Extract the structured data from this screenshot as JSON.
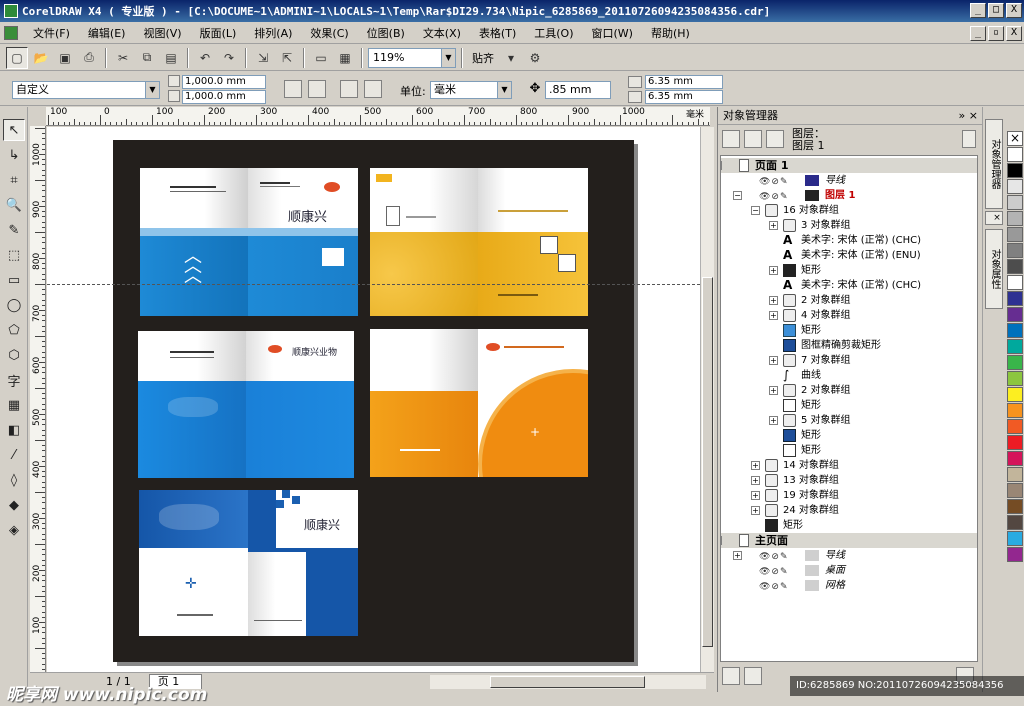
{
  "titlebar": {
    "title": "CorelDRAW X4 ( 专业版 ) - [C:\\DOCUME~1\\ADMINI~1\\LOCALS~1\\Temp\\Rar$DI29.734\\Nipic_6285869_20110726094235084356.cdr]",
    "btn_min": "_",
    "btn_max": "□",
    "btn_close": "X"
  },
  "menubar": {
    "items": [
      "文件(F)",
      "编辑(E)",
      "视图(V)",
      "版面(L)",
      "排列(A)",
      "效果(C)",
      "位图(B)",
      "文本(X)",
      "表格(T)",
      "工具(O)",
      "窗口(W)",
      "帮助(H)"
    ],
    "btn_min": "_",
    "btn_restore": "▫",
    "btn_close": "X"
  },
  "toolbar": {
    "zoom": "119%",
    "snap": "贴齐"
  },
  "propbar": {
    "preset": "自定义",
    "width": "1,000.0 mm",
    "height": "1,000.0 mm",
    "units_label": "单位:",
    "units": "毫米",
    "nudge": ".85 mm",
    "dup_x": "6.35 mm",
    "dup_y": "6.35 mm"
  },
  "ruler": {
    "h_labels": [
      "100",
      "0",
      "100",
      "200",
      "300",
      "400",
      "500",
      "600",
      "700",
      "800",
      "900",
      "1000",
      "毫米"
    ],
    "v_labels": [
      "1000",
      "900",
      "800",
      "700",
      "600",
      "500",
      "400",
      "300",
      "200",
      "100"
    ]
  },
  "brochures": {
    "b1_brand": "顺康兴",
    "b2_brand": "顺康兴业物",
    "b5_brand": "顺康兴"
  },
  "status": {
    "page_count": "1 / 1",
    "page_tab": "页 1"
  },
  "docker": {
    "title": "对象管理器",
    "layer_label_1": "图层：",
    "layer_label_2": "图层 1",
    "rows": [
      {
        "label": "页面 1",
        "type": "header"
      },
      {
        "label": "导线",
        "type": "layer"
      },
      {
        "label": "图层 1",
        "type": "layer1"
      },
      {
        "label": "16 对象群组",
        "type": "group"
      },
      {
        "label": "3 对象群组",
        "type": "group"
      },
      {
        "label": "美术字: 宋体 (正常) (CHC)",
        "type": "text"
      },
      {
        "label": "美术字: 宋体 (正常) (ENU)",
        "type": "text"
      },
      {
        "label": "矩形",
        "type": "rect-dark"
      },
      {
        "label": "美术字: 宋体 (正常) (CHC)",
        "type": "text"
      },
      {
        "label": "2 对象群组",
        "type": "group"
      },
      {
        "label": "4 对象群组",
        "type": "group"
      },
      {
        "label": "矩形",
        "type": "rect-blue"
      },
      {
        "label": "图框精确剪裁矩形",
        "type": "rect-navy"
      },
      {
        "label": "7 对象群组",
        "type": "group"
      },
      {
        "label": "曲线",
        "type": "curve"
      },
      {
        "label": "2 对象群组",
        "type": "group"
      },
      {
        "label": "矩形",
        "type": "rect-white"
      },
      {
        "label": "5 对象群组",
        "type": "group"
      },
      {
        "label": "矩形",
        "type": "rect-navy"
      },
      {
        "label": "矩形",
        "type": "rect-white"
      },
      {
        "label": "14 对象群组",
        "type": "group"
      },
      {
        "label": "13 对象群组",
        "type": "group"
      },
      {
        "label": "19 对象群组",
        "type": "group"
      },
      {
        "label": "24 对象群组",
        "type": "group"
      },
      {
        "label": "矩形",
        "type": "rect-dark"
      },
      {
        "label": "主页面",
        "type": "header"
      },
      {
        "label": "导线",
        "type": "layer"
      },
      {
        "label": "桌面",
        "type": "layer"
      },
      {
        "label": "网格",
        "type": "layer"
      }
    ]
  },
  "sidetabs": {
    "tab1": "对象管理器",
    "tab2": "对象属性"
  },
  "palette": {
    "colors": [
      "#ffffff",
      "#000000",
      "#e6e6e6",
      "#cccccc",
      "#b3b3b3",
      "#999999",
      "#808080",
      "#4d4d4d",
      "#ffffff",
      "#2e3192",
      "#662d91",
      "#0071bc",
      "#00a99d",
      "#39b54a",
      "#8cc63f",
      "#fcee21",
      "#f7931e",
      "#f15a24",
      "#ed1c24",
      "#d4145a",
      "#c2b59b",
      "#998675",
      "#754c24",
      "#534741",
      "#29abe2",
      "#93278f"
    ]
  },
  "watermark": {
    "logo": "昵享网 www.nipic.com",
    "id": "ID:6285869 NO:20110726094235084356"
  }
}
